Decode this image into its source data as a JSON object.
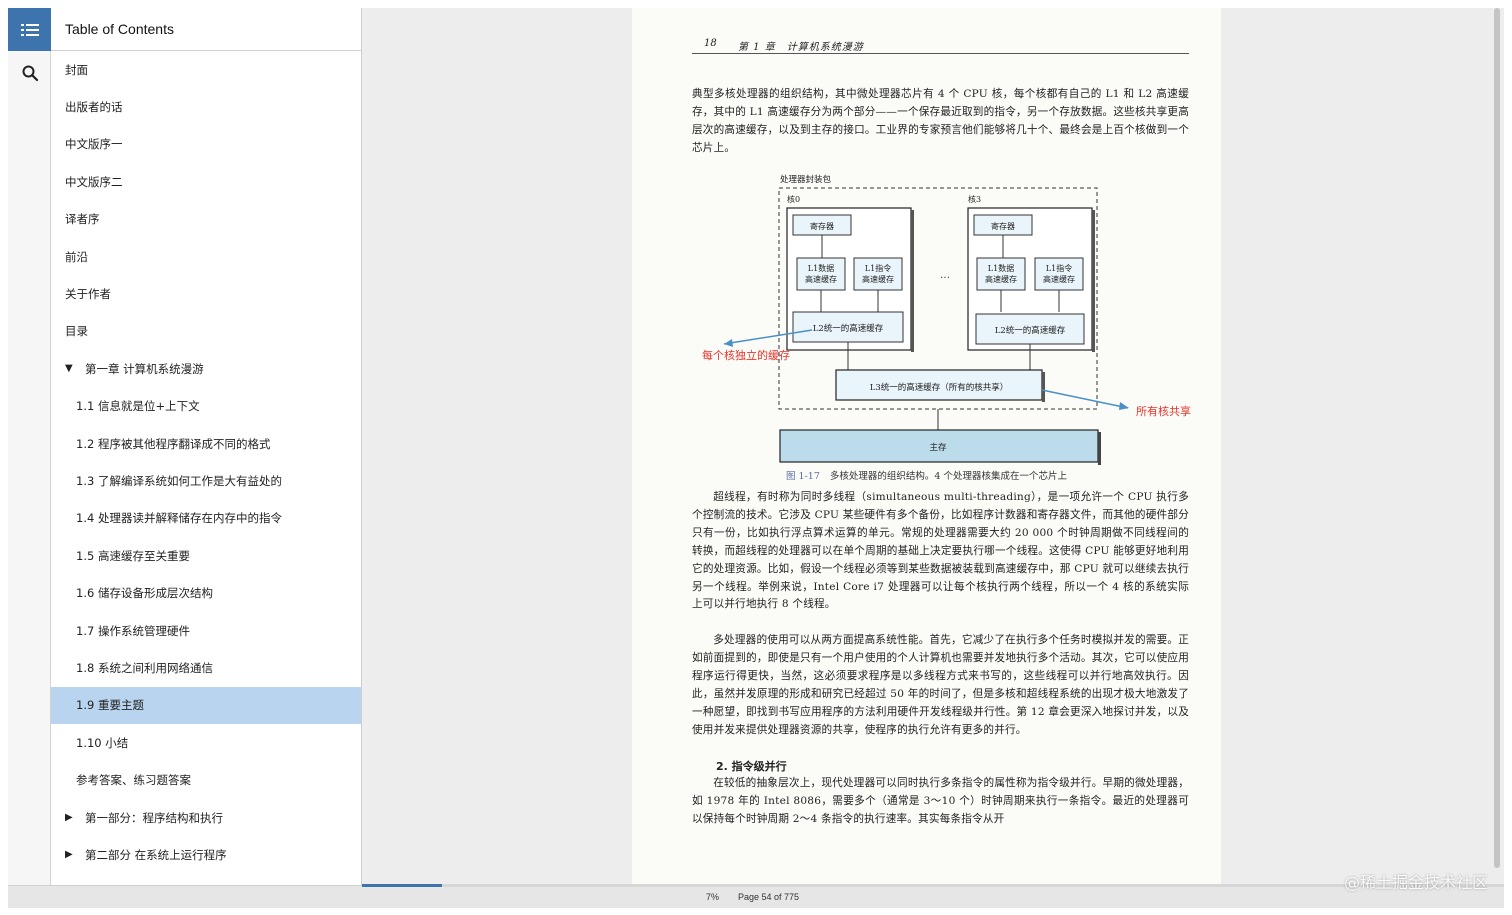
{
  "rail": {
    "toc_icon": "list-icon",
    "search_icon": "search-icon"
  },
  "toc": {
    "header": "Table of Contents",
    "items": [
      {
        "label": "封面",
        "level": 0
      },
      {
        "label": "出版者的话",
        "level": 0
      },
      {
        "label": "中文版序一",
        "level": 0
      },
      {
        "label": "中文版序二",
        "level": 0
      },
      {
        "label": "译者序",
        "level": 0
      },
      {
        "label": "前沿",
        "level": 0
      },
      {
        "label": "关于作者",
        "level": 0
      },
      {
        "label": "目录",
        "level": 0
      },
      {
        "label": "第一章 计算机系统漫游",
        "level": 0,
        "toggle": "▼"
      },
      {
        "label": "1.1 信息就是位+上下文",
        "level": 1
      },
      {
        "label": "1.2 程序被其他程序翻译成不同的格式",
        "level": 1
      },
      {
        "label": "1.3 了解编译系统如何工作是大有益处的",
        "level": 1
      },
      {
        "label": "1.4 处理器读并解释储存在内存中的指令",
        "level": 1
      },
      {
        "label": "1.5 高速缓存至关重要",
        "level": 1
      },
      {
        "label": "1.6 储存设备形成层次结构",
        "level": 1
      },
      {
        "label": "1.7 操作系统管理硬件",
        "level": 1
      },
      {
        "label": "1.8 系统之间利用网络通信",
        "level": 1
      },
      {
        "label": "1.9 重要主题",
        "level": 1,
        "active": true
      },
      {
        "label": "1.10 小结",
        "level": 1
      },
      {
        "label": "参考答案、练习题答案",
        "level": 1
      },
      {
        "label": "第一部分：程序结构和执行",
        "level": 0,
        "toggle": "▶"
      },
      {
        "label": "第二部分 在系统上运行程序",
        "level": 0,
        "toggle": "▶"
      }
    ]
  },
  "page": {
    "running_head_number": "18",
    "running_head_title": "第 1 章　计算机系统漫游",
    "para1": "典型多核处理器的组织结构，其中微处理器芯片有 4 个 CPU 核，每个核都有自己的 L1 和 L2 高速缓存，其中的 L1 高速缓存分为两个部分——一个保存最近取到的指令，另一个存放数据。这些核共享更高层次的高速缓存，以及到主存的接口。工业界的专家预言他们能够将几十个、最终会是上百个核做到一个芯片上。",
    "figure": {
      "package_label": "处理器封装包",
      "core0_label": "核0",
      "core3_label": "核3",
      "registers": "寄存器",
      "l1_data_1": "L1数据",
      "l1_data_2": "高速缓存",
      "l1_inst_1": "L1指令",
      "l1_inst_2": "高速缓存",
      "l2": "L2统一的高速缓存",
      "ellipsis": "…",
      "l3": "L3统一的高速缓存（所有的核共享）",
      "main_memory": "主存",
      "annotation_left": "每个核独立的缓存",
      "annotation_right": "所有核共享",
      "annotation_color": "#e8352b",
      "arrow_color": "#4a90c8",
      "caption_number": "图 1-17",
      "caption_text": "多核处理器的组织结构。4 个处理器核集成在一个芯片上"
    },
    "para2": "超线程，有时称为同时多线程（simultaneous multi-threading），是一项允许一个 CPU 执行多个控制流的技术。它涉及 CPU 某些硬件有多个备份，比如程序计数器和寄存器文件，而其他的硬件部分只有一份，比如执行浮点算术运算的单元。常规的处理器需要大约 20 000 个时钟周期做不同线程间的转换，而超线程的处理器可以在单个周期的基础上决定要执行哪一个线程。这使得 CPU 能够更好地利用它的处理资源。比如，假设一个线程必须等到某些数据被装载到高速缓存中，那 CPU 就可以继续去执行另一个线程。举例来说，Intel Core i7 处理器可以让每个核执行两个线程，所以一个 4 核的系统实际上可以并行地执行 8 个线程。",
    "para3": "多处理器的使用可以从两方面提高系统性能。首先，它减少了在执行多个任务时模拟并发的需要。正如前面提到的，即使是只有一个用户使用的个人计算机也需要并发地执行多个活动。其次，它可以使应用程序运行得更快，当然，这必须要求程序是以多线程方式来书写的，这些线程可以并行地高效执行。因此，虽然并发原理的形成和研究已经超过 50 年的时间了，但是多核和超线程系统的出现才极大地激发了一种愿望，即找到书写应用程序的方法利用硬件开发线程级并行性。第 12 章会更深入地探讨并发，以及使用并发来提供处理器资源的共享，使程序的执行允许有更多的并行。",
    "section_heading": "2. 指令级并行",
    "para4": "在较低的抽象层次上，现代处理器可以同时执行多条指令的属性称为指令级并行。早期的微处理器，如 1978 年的 Intel 8086，需要多个（通常是 3～10 个）时钟周期来执行一条指令。最近的处理器可以保持每个时钟周期 2～4 条指令的执行速率。其实每条指令从开"
  },
  "footer": {
    "percent_label": "7%",
    "progress": 0.07,
    "page_label": "Page 54 of 775",
    "accent": "#3e74ad"
  },
  "watermark": "@稀土掘金技术社区"
}
